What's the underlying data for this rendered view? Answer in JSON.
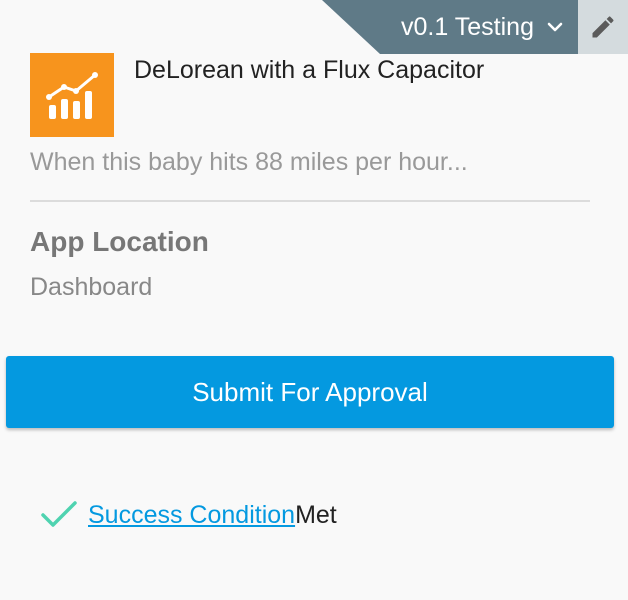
{
  "version_selector": {
    "label": "v0.1 Testing",
    "icon": "chevron-down-icon",
    "background": "#5f7a87"
  },
  "edit_button": {
    "icon": "pencil-icon",
    "background": "#d4dbde"
  },
  "app": {
    "logo_icon": "bar-chart-trend-icon",
    "logo_color": "#f7941d",
    "name": "DeLorean with a Flux Capacitor",
    "description": "When this baby hits 88 miles per hour..."
  },
  "app_location": {
    "title": "App Location",
    "value": "Dashboard"
  },
  "submit": {
    "label": "Submit For Approval",
    "color": "#0499e0"
  },
  "success": {
    "icon": "checkmark-icon",
    "icon_color": "#4fd3b0",
    "link_text": "Success Condition ",
    "suffix": "Met"
  }
}
